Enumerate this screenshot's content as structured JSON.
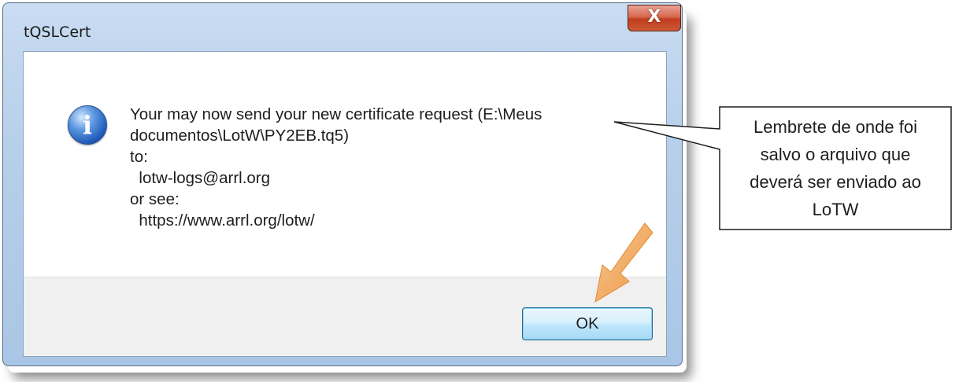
{
  "window": {
    "title": "tQSLCert",
    "close_glyph": "X"
  },
  "dialog": {
    "icon": "info-icon",
    "icon_glyph": "i",
    "message_lines": [
      "Your may now send your new certificate request (E:\\Meus",
      "documentos\\LotW\\PY2EB.tq5)",
      "to:",
      "  lotw-logs@arrl.org",
      "or see:",
      "  https://www.arrl.org/lotw/"
    ],
    "ok_label": "OK"
  },
  "callout": {
    "lines": [
      "Lembrete de onde foi",
      "salvo o arquivo que",
      "deverá ser enviado ao",
      "LoTW"
    ]
  },
  "colors": {
    "arrow": "#f0a35a",
    "close_button": "#c7472a",
    "info_icon": "#1d56b6"
  }
}
